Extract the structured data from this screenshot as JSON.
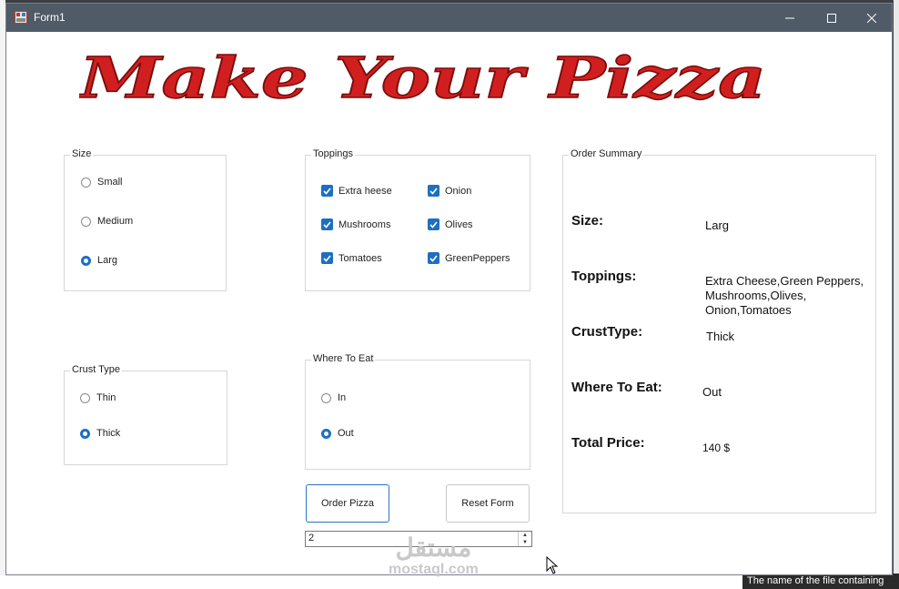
{
  "window": {
    "title": "Form1"
  },
  "logo": {
    "text": "Make Your Pizza",
    "color": "#d11f1f"
  },
  "size_group": {
    "label": "Size",
    "options": [
      {
        "label": "Small",
        "selected": false
      },
      {
        "label": "Medium",
        "selected": false
      },
      {
        "label": "Larg",
        "selected": true
      }
    ]
  },
  "toppings_group": {
    "label": "Toppings",
    "items": [
      {
        "label": "Extra heese",
        "checked": true
      },
      {
        "label": "Onion",
        "checked": true
      },
      {
        "label": "Mushrooms",
        "checked": true
      },
      {
        "label": "Olives",
        "checked": true
      },
      {
        "label": "Tomatoes",
        "checked": true
      },
      {
        "label": "GreenPeppers",
        "checked": true
      }
    ]
  },
  "crust_group": {
    "label": "Crust Type",
    "options": [
      {
        "label": "Thin",
        "selected": false
      },
      {
        "label": "Thick",
        "selected": true
      }
    ]
  },
  "where_group": {
    "label": "Where To Eat",
    "options": [
      {
        "label": "In",
        "selected": false
      },
      {
        "label": "Out",
        "selected": true
      }
    ]
  },
  "summary": {
    "label": "Order Summary",
    "size_key": "Size:",
    "size_val": "Larg",
    "toppings_key": "Toppings:",
    "toppings_lines": [
      "Extra Cheese,Green Peppers,",
      "Mushrooms,Olives,",
      "Onion,Tomatoes"
    ],
    "crust_key": "CrustType:",
    "crust_val": "Thick",
    "where_key": "Where To Eat:",
    "where_val": "Out",
    "price_key": "Total Price:",
    "price_val": "140 $"
  },
  "buttons": {
    "order": "Order Pizza",
    "reset": "Reset Form"
  },
  "quantity": {
    "value": "2"
  },
  "watermark": {
    "arabic": "مستقل",
    "latin": "mostaql.com"
  },
  "background_caption": "The name of the file containing",
  "colors": {
    "titlebar": "#4f5b66",
    "accent": "#1d6fc1"
  }
}
